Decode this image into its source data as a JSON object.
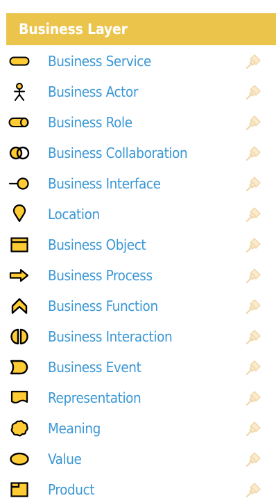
{
  "panel": {
    "title": "Business Layer",
    "header_color": "#EBC44C",
    "label_color": "#3A97D5",
    "icon_fill": "#FFCC33"
  },
  "items": [
    {
      "label": "Business Service",
      "icon": "business-service-icon"
    },
    {
      "label": "Business Actor",
      "icon": "business-actor-icon"
    },
    {
      "label": "Business Role",
      "icon": "business-role-icon"
    },
    {
      "label": "Business Collaboration",
      "icon": "business-collaboration-icon"
    },
    {
      "label": "Business Interface",
      "icon": "business-interface-icon"
    },
    {
      "label": "Location",
      "icon": "location-icon"
    },
    {
      "label": "Business Object",
      "icon": "business-object-icon"
    },
    {
      "label": "Business Process",
      "icon": "business-process-icon"
    },
    {
      "label": "Business Function",
      "icon": "business-function-icon"
    },
    {
      "label": "Business Interaction",
      "icon": "business-interaction-icon"
    },
    {
      "label": "Business Event",
      "icon": "business-event-icon"
    },
    {
      "label": "Representation",
      "icon": "representation-icon"
    },
    {
      "label": "Meaning",
      "icon": "meaning-icon"
    },
    {
      "label": "Value",
      "icon": "value-icon"
    },
    {
      "label": "Product",
      "icon": "product-icon"
    }
  ]
}
